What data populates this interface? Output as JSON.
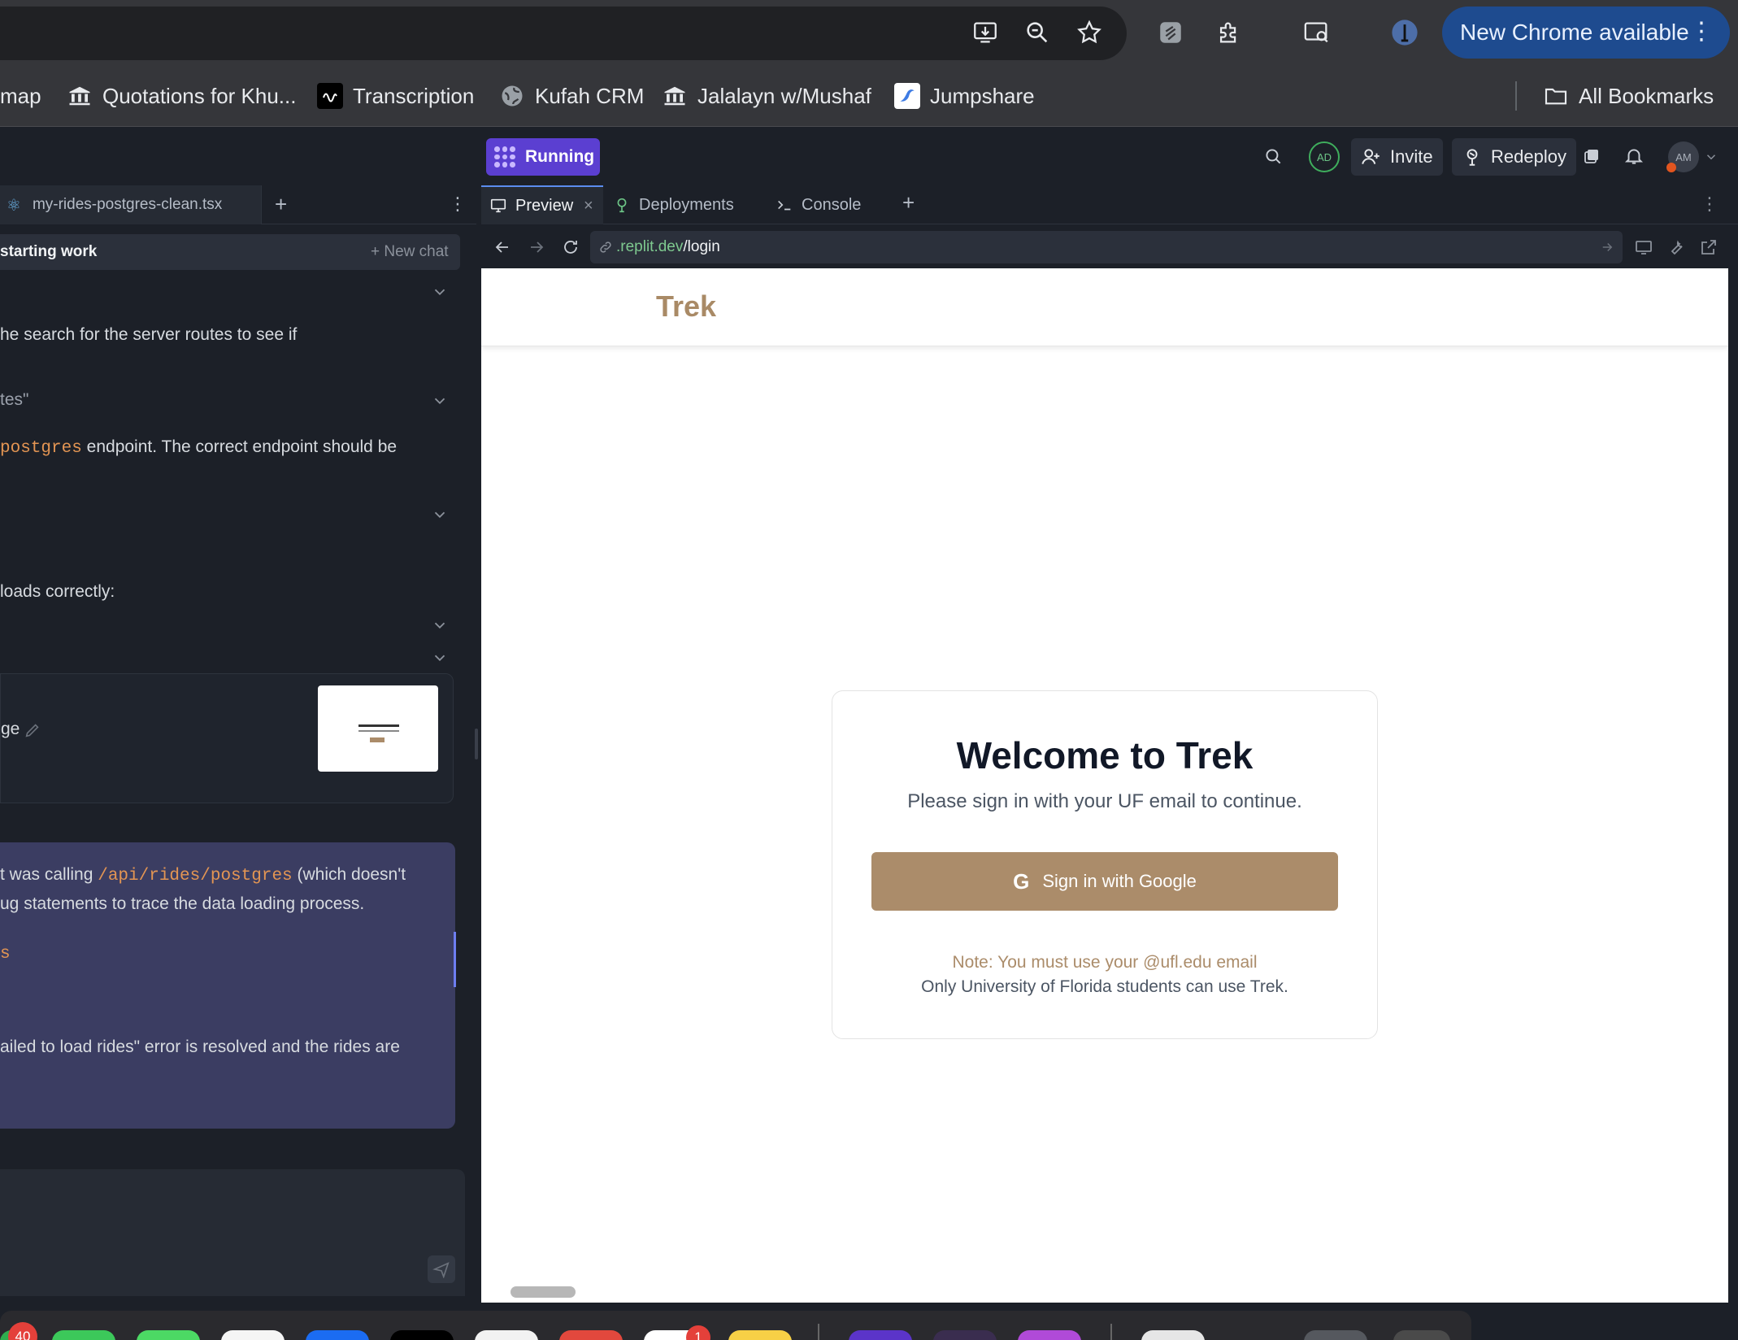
{
  "browser": {
    "new_chrome_label": "New Chrome available",
    "menu_glyph": "⋮",
    "toolbar_icons": [
      "install-icon",
      "zoom-icon",
      "star-icon",
      "extension-icon",
      "puzzle-icon",
      "tab-search-icon",
      "profile-avatar"
    ]
  },
  "bookmarks": {
    "items": [
      {
        "label": "map",
        "icon": "none"
      },
      {
        "label": "Quotations for Khu...",
        "icon": "columns-icon"
      },
      {
        "label": "Transcription",
        "icon": "wave-icon"
      },
      {
        "label": "Kufah CRM",
        "icon": "globe-icon"
      },
      {
        "label": "Jalalayn w/Mushaf",
        "icon": "columns-icon"
      },
      {
        "label": "Jumpshare",
        "icon": "jumpshare-icon"
      }
    ],
    "all_bookmarks": "All Bookmarks"
  },
  "replit": {
    "status": "Running",
    "avatar_initials": "AD",
    "invite_label": "Invite",
    "redeploy_label": "Redeploy",
    "user_initials": "AM"
  },
  "left_panel": {
    "file_tab": "my-rides-postgres-clean.tsx",
    "chat_title": "starting work",
    "new_chat": "+ New chat",
    "lines": {
      "l1": "he search for the server routes to see if",
      "l2": "tes\"",
      "l3_code": "postgres",
      "l3_rest": " endpoint. The correct endpoint should be",
      "l4": "loads correctly:",
      "l5": "ge",
      "m1_pre": "t was calling ",
      "m1_code": "/api/rides/postgres",
      "m1_post": " (which doesn't",
      "m2": "ug statements to trace the data loading process.",
      "m3_code": "s",
      "m4": "ailed to load rides\" error is resolved and the rides are"
    }
  },
  "right_panel": {
    "tabs": [
      {
        "label": "Preview",
        "icon": "monitor-icon"
      },
      {
        "label": "Deployments",
        "icon": "deploy-icon"
      },
      {
        "label": "Console",
        "icon": "terminal-icon"
      }
    ],
    "url_domain": ".replit.dev",
    "url_path": "/login"
  },
  "webapp": {
    "logo": "Trek",
    "welcome": "Welcome to Trek",
    "subtitle": "Please sign in with your UF email to continue.",
    "google_button": "Sign in with Google",
    "google_glyph": "G",
    "note": "Note: You must use your @ufl.edu email",
    "only": "Only University of Florida students can use Trek."
  },
  "dock": {
    "badges": [
      "40",
      "1"
    ]
  },
  "colors": {
    "brand_tan": "#ab8c6a",
    "running_purple": "#5b3fd1",
    "chrome_blue": "#1e4b8f"
  }
}
